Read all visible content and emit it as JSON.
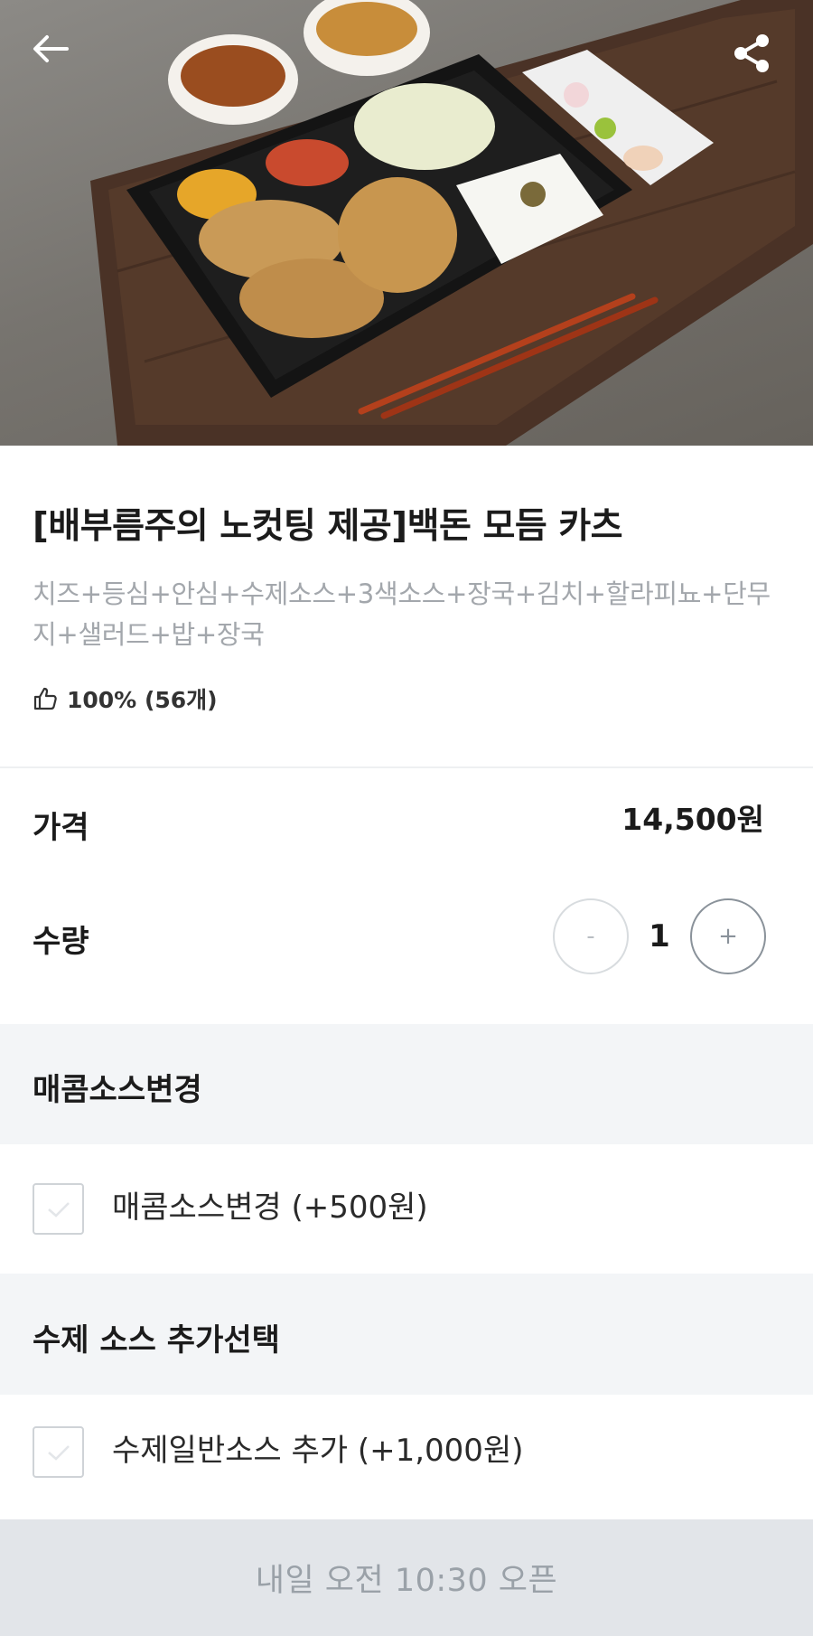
{
  "header": {
    "back_icon": "arrow-left-icon",
    "share_icon": "share-icon"
  },
  "product": {
    "title": "[배부름주의 노컷팅 제공]백돈 모듬 카츠",
    "description": "치즈+등심+안심+수제소스+3색소스+장국+김치+할라피뇨+단무지+샐러드+밥+장국",
    "rating_icon": "thumbs-up-icon",
    "rating": "100% (56개)"
  },
  "price": {
    "label": "가격",
    "value": "14,500원"
  },
  "quantity": {
    "label": "수량",
    "minus": "-",
    "value": "1",
    "plus": "+"
  },
  "option_groups": [
    {
      "title": "매콤소스변경",
      "options": [
        {
          "label": "매콤소스변경 (+500원)",
          "checked": false
        }
      ]
    },
    {
      "title": "수제 소스 추가선택",
      "options": [
        {
          "label": "수제일반소스 추가 (+1,000원)",
          "checked": false
        }
      ]
    }
  ],
  "bottom_bar": {
    "label": "내일 오전 10:30 오픈"
  },
  "colors": {
    "section_bg": "#f3f5f7",
    "bottom_bar_bg": "#e2e5e9",
    "muted_text": "#a3a7ac"
  }
}
